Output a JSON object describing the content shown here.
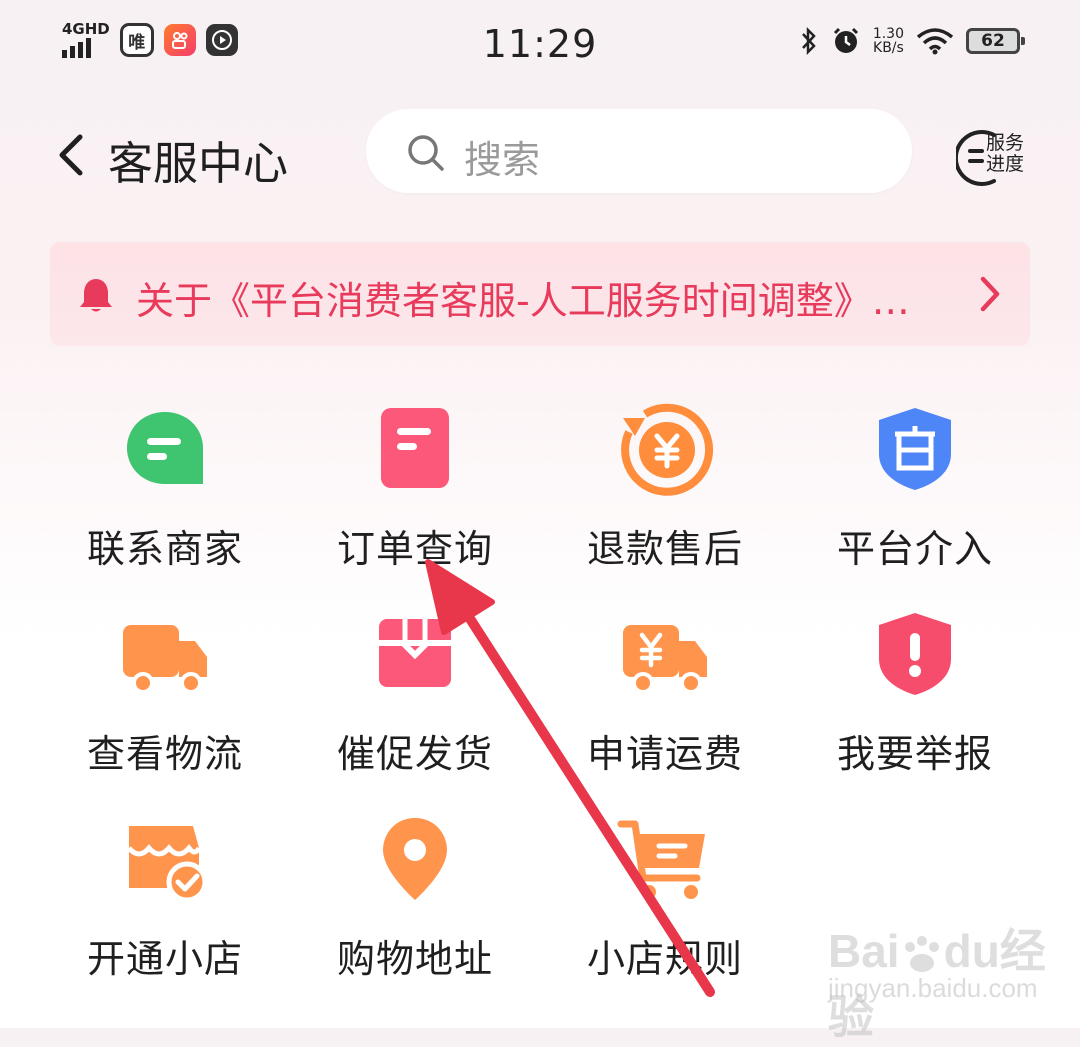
{
  "status_bar": {
    "time": "11:29",
    "network": "4GHD",
    "app_icon_1": "唯",
    "net_speed_value": "1.30",
    "net_speed_unit": "KB/s",
    "battery": "62"
  },
  "header": {
    "title": "客服中心",
    "search_placeholder": "搜索",
    "service_progress_line1": "服务",
    "service_progress_line2": "进度"
  },
  "notice": {
    "text": "关于《平台消费者客服-人工服务时间调整》…"
  },
  "grid": {
    "items": [
      {
        "label": "联系商家",
        "icon": "chat-bubble-icon",
        "color": "#3fc470"
      },
      {
        "label": "订单查询",
        "icon": "order-document-icon",
        "color": "#fb587a"
      },
      {
        "label": "退款售后",
        "icon": "refund-yen-icon",
        "color": "#ff8d3c"
      },
      {
        "label": "平台介入",
        "icon": "official-shield-icon",
        "color": "#4f86f7"
      },
      {
        "label": "查看物流",
        "icon": "delivery-truck-icon",
        "color": "#ff944d"
      },
      {
        "label": "催促发货",
        "icon": "package-box-icon",
        "color": "#fb587a"
      },
      {
        "label": "申请运费",
        "icon": "freight-yen-truck-icon",
        "color": "#ff944d"
      },
      {
        "label": "我要举报",
        "icon": "report-shield-icon",
        "color": "#f74d6d"
      },
      {
        "label": "开通小店",
        "icon": "open-shop-icon",
        "color": "#ff944d"
      },
      {
        "label": "购物地址",
        "icon": "location-pin-icon",
        "color": "#ff944d"
      },
      {
        "label": "小店规则",
        "icon": "shop-rules-cart-icon",
        "color": "#ff944d"
      }
    ]
  },
  "annotation": {
    "arrow_color": "#e8374a"
  },
  "watermark": {
    "brand": "Bai",
    "brand2": "du",
    "brand3": "经验",
    "url": "jingyan.baidu.com"
  }
}
